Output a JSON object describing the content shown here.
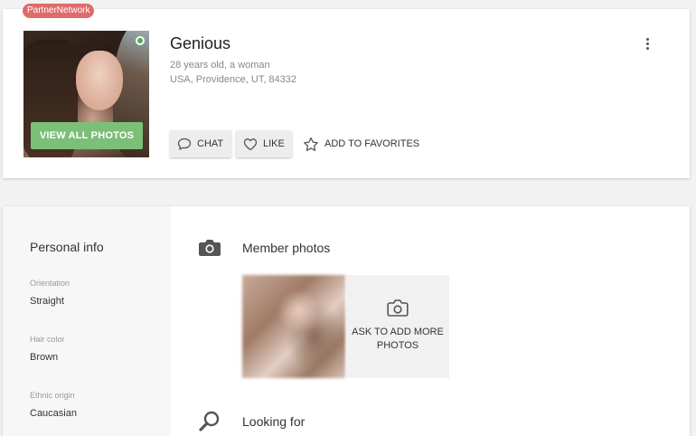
{
  "badge": "PartnerNetwork",
  "profile": {
    "name": "Genious",
    "age_gender": "28 years old, a woman",
    "location": "USA, Providence, UT, 84332",
    "view_photos_label": "VIEW ALL PHOTOS",
    "status": "online"
  },
  "actions": {
    "chat_label": "CHAT",
    "like_label": "LIKE",
    "favorites_label": "ADD TO FAVORITES"
  },
  "personal_info": {
    "title": "Personal info",
    "attributes": [
      {
        "label": "Orientation",
        "value": "Straight"
      },
      {
        "label": "Hair color",
        "value": "Brown"
      },
      {
        "label": "Ethnic origin",
        "value": "Caucasian"
      }
    ]
  },
  "member_photos": {
    "title": "Member photos",
    "ask_more_label": "ASK TO ADD MORE PHOTOS"
  },
  "looking_for": {
    "title": "Looking for"
  },
  "colors": {
    "badge": "#e06b6b",
    "view_photos_button": "#7cbf78",
    "online": "#4caf50"
  },
  "icons": [
    "chat-icon",
    "heart-icon",
    "star-icon",
    "camera-icon",
    "search-icon",
    "more-vertical-icon"
  ]
}
